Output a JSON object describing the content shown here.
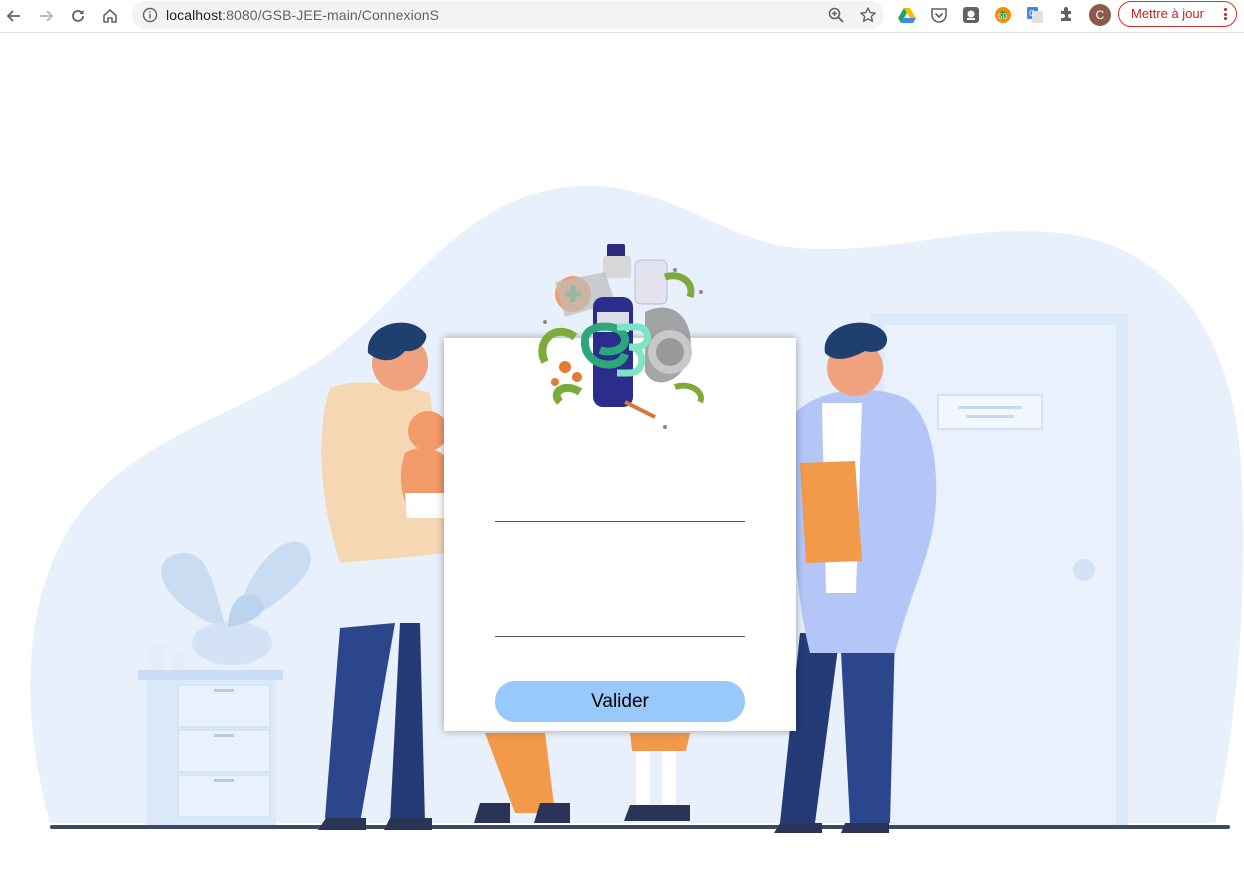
{
  "browser": {
    "url_host": "localhost",
    "url_path": ":8080/GSB-JEE-main/ConnexionS",
    "profile_initial": "C",
    "update_label": "Mettre à jour"
  },
  "login": {
    "login_value": "",
    "password_value": "",
    "submit_label": "Valider"
  },
  "colors": {
    "accent_button": "#99c8fb",
    "blob_background": "#e8f1fb",
    "update_red": "#c5221f"
  }
}
